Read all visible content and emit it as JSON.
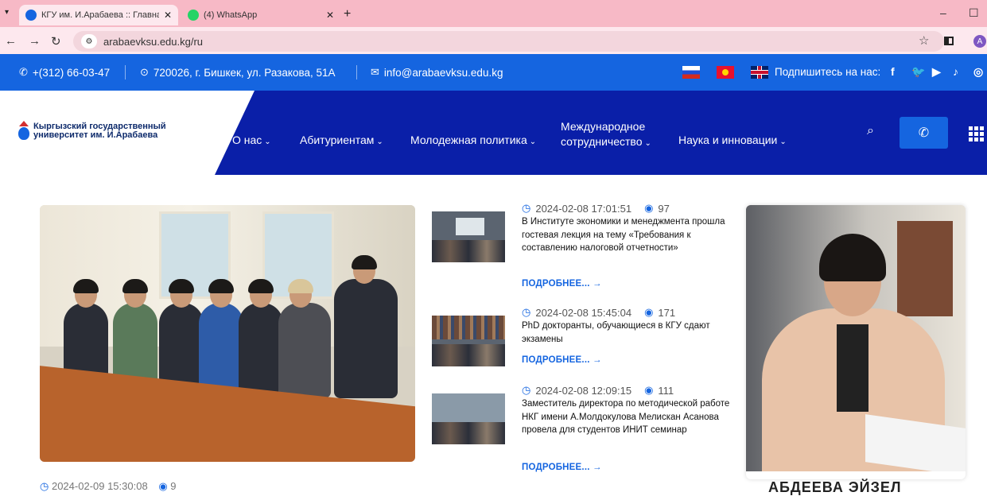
{
  "browser": {
    "tabs": [
      {
        "title": "КГУ им. И.Арабаева :: Главная",
        "active": true
      },
      {
        "title": "(4) WhatsApp",
        "active": false
      }
    ],
    "close_glyph": "✕",
    "new_tab_glyph": "+",
    "url": "arabaevksu.edu.kg/ru",
    "profile_initial": "A"
  },
  "topbar": {
    "phone": "+(312) 66-03-47",
    "address": "720026, г. Бишкек, ул. Разакова, 51А",
    "email": "info@arabaevksu.edu.kg",
    "subscribe_label": "Подпишитесь на нас:",
    "social": [
      "facebook-icon",
      "twitter-icon",
      "youtube-icon",
      "tiktok-icon",
      "instagram-icon"
    ],
    "color": "#1565e0"
  },
  "header": {
    "logo_line1": "Кыргызский государственный",
    "logo_line2": "университет им. И.Арабаева",
    "menu": [
      {
        "label": "О нас"
      },
      {
        "label": "Абитуриентам"
      },
      {
        "label": "Молодежная политика"
      },
      {
        "label_line1": "Международное",
        "label_line2": "сотрудничество"
      },
      {
        "label": "Наука и инновации"
      }
    ],
    "color": "#0a1fa8"
  },
  "news": [
    {
      "date": "2024-02-08 17:01:51",
      "views": "97",
      "title": "В Институте экономики и менеджмента прошла гостевая лекция на тему «Требования к составлению налоговой отчетности»",
      "more": "ПОДРОБНЕЕ... →"
    },
    {
      "date": "2024-02-08 15:45:04",
      "views": "171",
      "title": "PhD докторанты, обучающиеся в КГУ сдают экзамены",
      "more": "ПОДРОБНЕЕ... →"
    },
    {
      "date": "2024-02-08 12:09:15",
      "views": "111",
      "title": "Заместитель директора по методической работе НКГ имени А.Молдокулова Мелискан Асанова провела для студентов ИНИТ семинар",
      "more": "ПОДРОБНЕЕ... →"
    }
  ],
  "main_news_meta": "2024-02-09 15:30:08",
  "main_news_views": "9",
  "rector_name": "АБДЕЕВА ЭЙЗЕЛ"
}
